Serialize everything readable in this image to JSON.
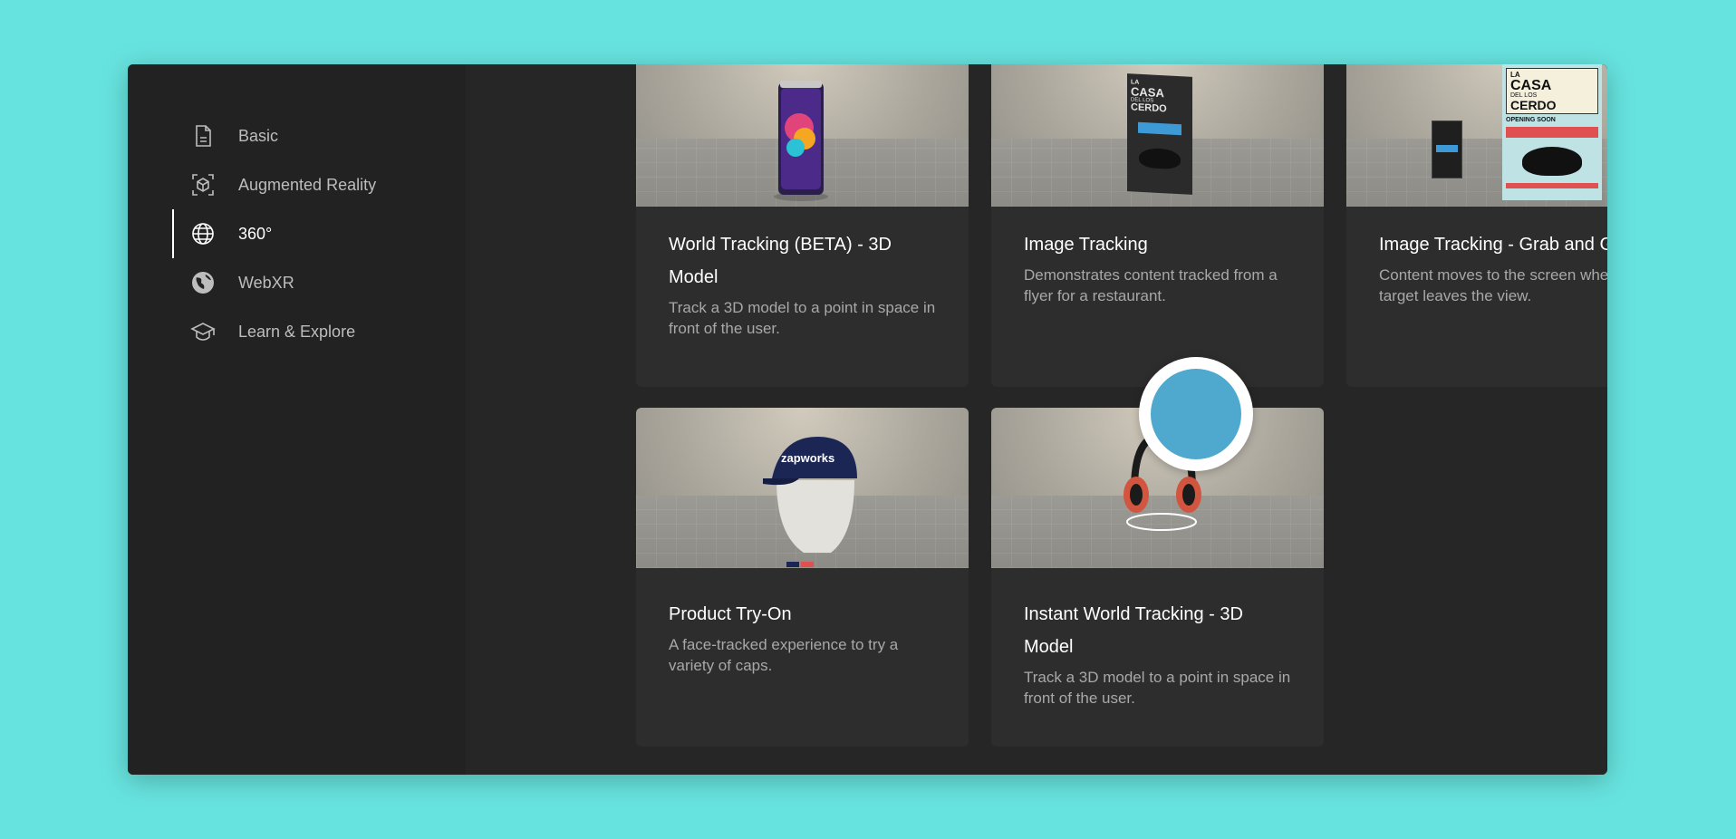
{
  "sidebar": {
    "items": [
      {
        "label": "Basic",
        "icon": "document-icon",
        "active": false
      },
      {
        "label": "Augmented Reality",
        "icon": "ar-cube-icon",
        "active": false
      },
      {
        "label": "360°",
        "icon": "globe-icon",
        "active": true
      },
      {
        "label": "WebXR",
        "icon": "earth-icon",
        "active": false
      },
      {
        "label": "Learn & Explore",
        "icon": "graduation-cap-icon",
        "active": false
      }
    ]
  },
  "cards": [
    {
      "title": "World Tracking (BETA) - 3D Model",
      "description": "Track a 3D model to a point in space in front of the user."
    },
    {
      "title": "Image Tracking",
      "description": "Demonstrates content tracked from a flyer for a restaurant."
    },
    {
      "title": "Image Tracking - Grab and Go",
      "description": "Content moves to the screen when the target leaves the view."
    },
    {
      "title": "Product Try-On",
      "description": "A face-tracked experience to try a variety of caps."
    },
    {
      "title": "Instant World Tracking - 3D Model",
      "description": "Track a 3D model to a point in space in front of the user."
    }
  ],
  "thumbnails": {
    "flyer_small": {
      "line1": "LA",
      "line2": "CASA",
      "line3": "DEL LOS",
      "line4": "CERDO"
    },
    "flyer_large": {
      "line1": "LA",
      "line2": "CASA",
      "line3": "DEL LOS",
      "line4": "CERDO",
      "line5": "OPENING SOON"
    },
    "cap_brand": "zapworks"
  },
  "colors": {
    "background": "#67e3df",
    "window": "#262626",
    "sidebar": "#222222",
    "card": "#2d2d2d",
    "cursor": "#4fa9cf"
  }
}
